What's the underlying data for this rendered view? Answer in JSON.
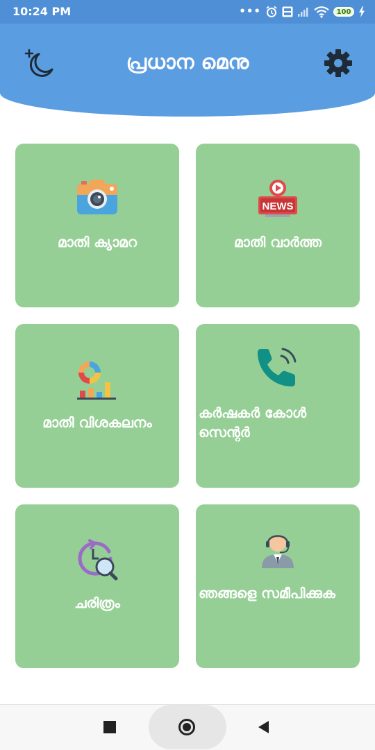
{
  "status_bar": {
    "time": "10:24 PM",
    "battery": "100",
    "icons": [
      "more-dots-icon",
      "alarm-icon",
      "volte-icon",
      "signal-icon",
      "wifi-icon",
      "battery-icon",
      "charging-icon"
    ]
  },
  "header": {
    "title": "പ്രധാന മെനു",
    "left_icon": "dark-mode-moon-icon",
    "right_icon": "settings-gear-icon",
    "color": "#5b9de1"
  },
  "tiles": [
    {
      "label": "മാതി ക്യാമറ",
      "icon": "camera-icon"
    },
    {
      "label": "മാതി വാർത്ത",
      "icon": "news-icon"
    },
    {
      "label": "മാതി വിശകലനം",
      "icon": "analytics-chart-icon"
    },
    {
      "label": "കർഷകർ കോൾ സെന്റർ",
      "icon": "phone-icon"
    },
    {
      "label": "ചരിത്രം",
      "icon": "history-search-icon"
    },
    {
      "label": "ഞങ്ങളെ സമീപിക്കുക",
      "icon": "support-agent-icon"
    }
  ],
  "nav_bar": {
    "buttons": [
      "recent-apps-icon",
      "home-icon",
      "back-icon"
    ]
  },
  "colors": {
    "tile": "#95cf95",
    "status_bar": "#4f8fd6"
  }
}
